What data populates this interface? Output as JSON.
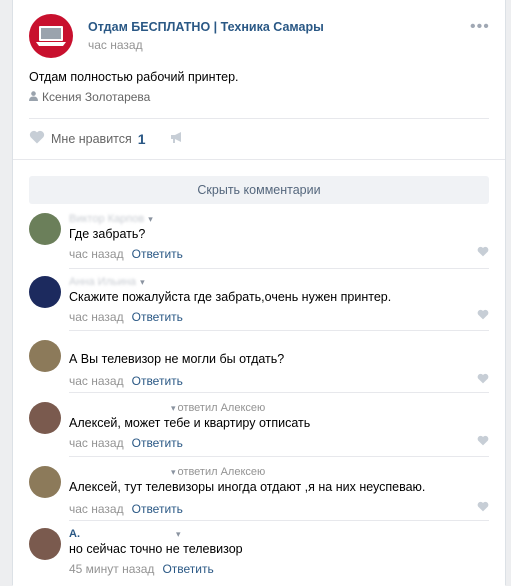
{
  "post": {
    "group_name": "Отдам БЕСПЛАТНО | Техника Самары",
    "time": "час назад",
    "more": "•••",
    "text": "Отдам полностью рабочий принтер.",
    "author": "Ксения Золотарева",
    "likes_label": "Мне нравится",
    "likes_count": "1"
  },
  "comments_toggle": "Скрыть комментарии",
  "comments": [
    {
      "name": "Виктор Карпов",
      "reply_to": "",
      "text": "Где забрать?",
      "time": "час назад",
      "answer": "Ответить",
      "avatar_color": "#6b7f5a"
    },
    {
      "name": "Анна Ильина",
      "reply_to": "",
      "text": "Скажите пожалуйста где забрать,очень нужен принтер.",
      "time": "час назад",
      "answer": "Ответить",
      "avatar_color": "#1c2a5e"
    },
    {
      "name": "",
      "reply_to": "",
      "text": "А Вы телевизор не могли бы отдать?",
      "time": "час назад",
      "answer": "Ответить",
      "avatar_color": "#8c7a5a"
    },
    {
      "name": "",
      "reply_to": "ответил Алексею",
      "text": "Алексей, может тебе и квартиру отписать",
      "time": "час назад",
      "answer": "Ответить",
      "avatar_color": "#7a5a4e"
    },
    {
      "name": "",
      "reply_to": "ответил Алексею",
      "text": "Алексей, тут телевизоры иногда отдают ,я на них неуспеваю.",
      "time": "час назад",
      "answer": "Ответить",
      "avatar_color": "#8c7a5a"
    },
    {
      "name": "А.",
      "reply_to": "",
      "text": "но сейчас точно не телевизор",
      "time": "45 минут назад",
      "answer": "Ответить",
      "avatar_color": "#7a5a4e"
    }
  ],
  "colors": {
    "link": "#2a5885",
    "muted": "#939393",
    "group_avatar": "#c8102e"
  }
}
